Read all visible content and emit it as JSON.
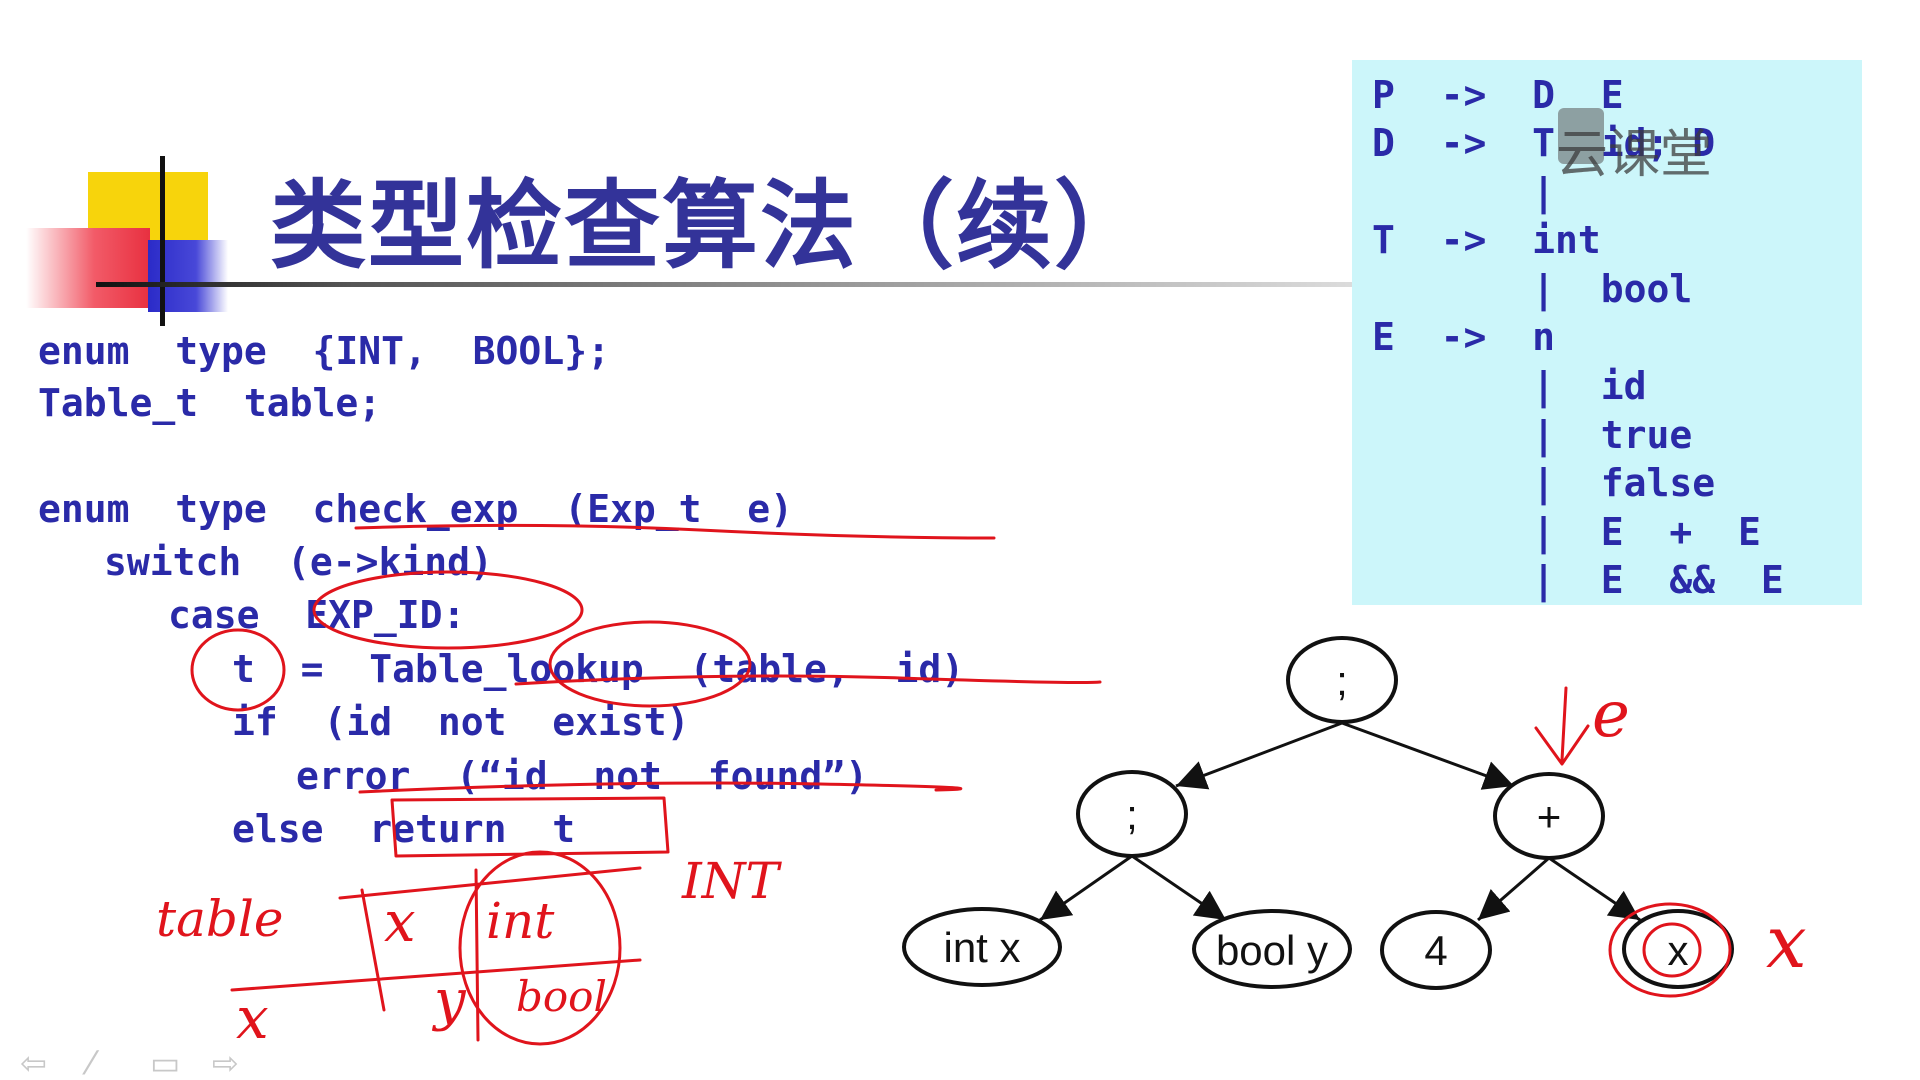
{
  "title": "类型检查算法（续）",
  "watermark": "云课堂",
  "grammar": [
    "P  ->  D  E",
    "D  ->  T  id; D",
    "       |",
    "T  ->  int",
    "       |  bool",
    "E  ->  n",
    "       |  id",
    "       |  true",
    "       |  false",
    "       |  E  +  E",
    "       |  E  &&  E"
  ],
  "code": [
    "enum  type  {INT,  BOOL};",
    "Table_t  table;",
    "enum  type  check_exp  (Exp_t  e)",
    "switch  (e->kind)",
    "case  EXP_ID:",
    "t  =  Table_lookup  (table,  id)",
    "if  (id  not  exist)",
    "error  (“id  not  found”)",
    "else  return  t"
  ],
  "tree": {
    "root": ";",
    "left": ";",
    "right": "+",
    "leaf1": "int x",
    "leaf2": "bool y",
    "leaf3": "4",
    "leaf4": "x"
  },
  "annotations": {
    "e": "e",
    "x": "x",
    "int_note": "INT",
    "table": "table",
    "cell_x": "x",
    "cell_int": "int",
    "cell_y": "y",
    "cell_bool": "bool",
    "lone_x": "x"
  },
  "nav": {
    "prev": "⇦",
    "pen": "⁄",
    "menu": "▭",
    "next": "⇨"
  },
  "colors": {
    "text_blue": "#2a2aa8",
    "title_blue": "#333399",
    "grammar_bg": "#ccf6fa",
    "ink_red": "#e0141c"
  }
}
